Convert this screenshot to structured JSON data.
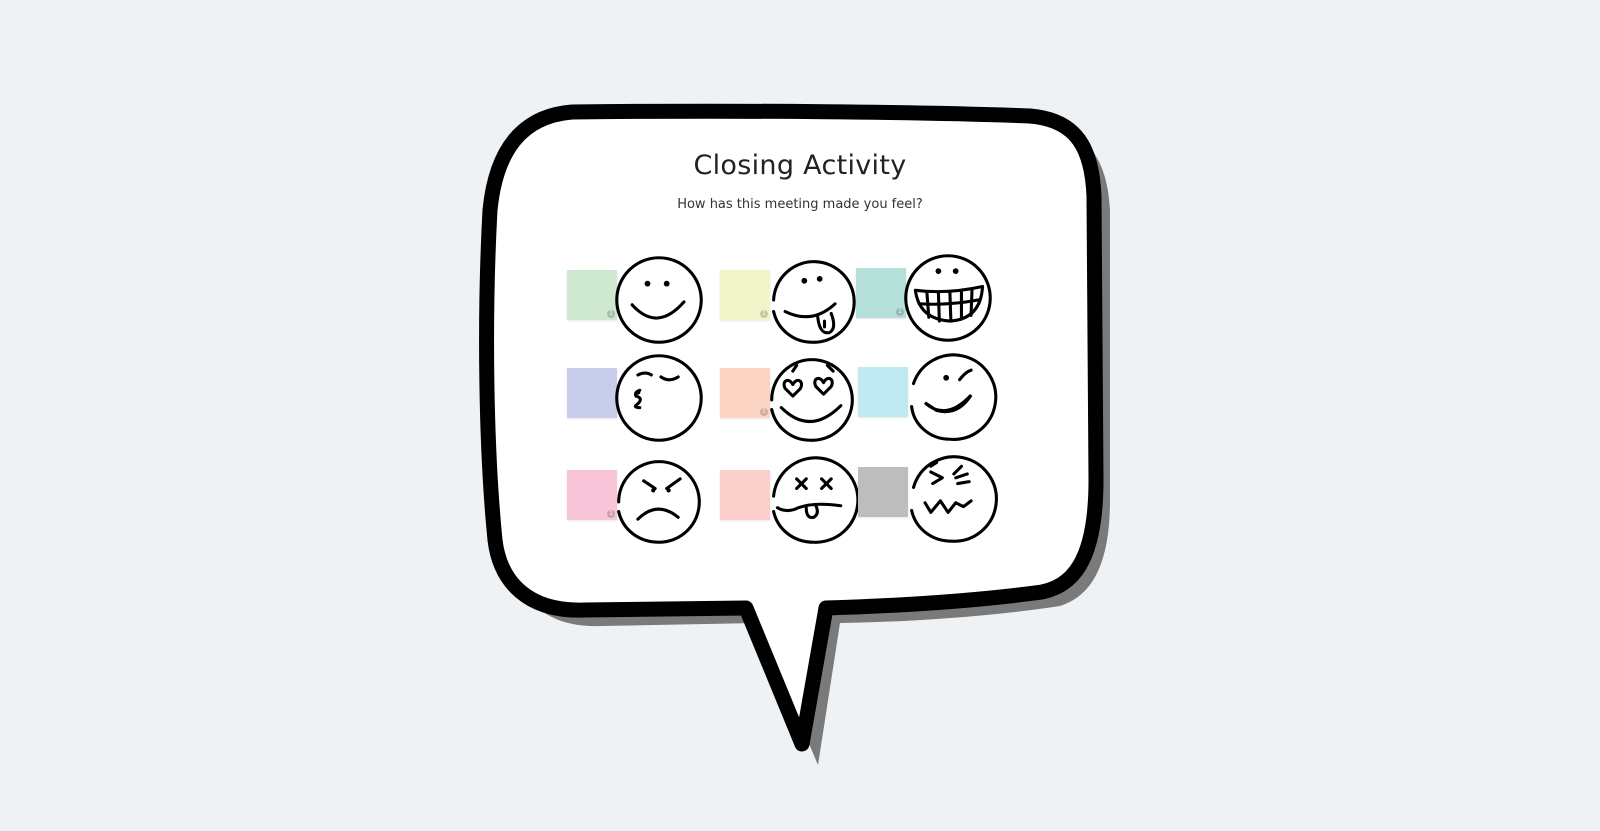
{
  "board": {
    "title": "Closing Activity",
    "subtitle": "How has this meeting made you feel?"
  },
  "colors": {
    "background": "#eef2f5",
    "bubble_fill": "#ffffff",
    "bubble_outline": "#000000",
    "bubble_shadow": "#7a7a7a"
  },
  "emotions": [
    {
      "face": "smile-face-icon",
      "sticky_color": "#cfe8d0",
      "badge": "1"
    },
    {
      "face": "tongue-out-face-icon",
      "sticky_color": "#f1f5c9",
      "badge": "1"
    },
    {
      "face": "big-grin-face-icon",
      "sticky_color": "#b5e0da",
      "badge": "1"
    },
    {
      "face": "kissing-face-icon",
      "sticky_color": "#c9cdec",
      "badge": ""
    },
    {
      "face": "heart-eyes-face-icon",
      "sticky_color": "#fdd3c4",
      "badge": "2"
    },
    {
      "face": "winking-face-icon",
      "sticky_color": "#bfeaf2",
      "badge": ""
    },
    {
      "face": "angry-face-icon",
      "sticky_color": "#f8c5d8",
      "badge": "1"
    },
    {
      "face": "dizzy-face-icon",
      "sticky_color": "#fbcfcb",
      "badge": ""
    },
    {
      "face": "frustrated-face-icon",
      "sticky_color": "#bdbdbd",
      "badge": ""
    }
  ]
}
